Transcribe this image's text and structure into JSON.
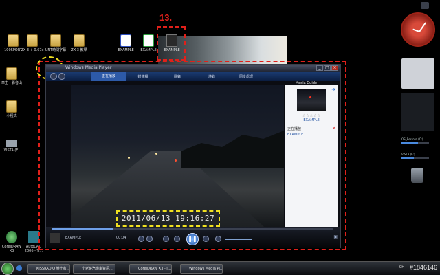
{
  "annotation": {
    "step_label": "13."
  },
  "desktop_icons": [
    {
      "label": "100SPORT"
    },
    {
      "label": "ZX-3 + 0.67x"
    },
    {
      "label": "UNT時間字幕"
    },
    {
      "label": "ZX-3 教學"
    },
    {
      "label": "EXAMPLE"
    },
    {
      "label": "EXAMPLE"
    },
    {
      "label": "EXAMPLE"
    },
    {
      "label": "車主 - 影音山"
    },
    {
      "label": "小程式"
    },
    {
      "label": "VISTA (E)"
    },
    {
      "label": "CorelDRAW X3"
    },
    {
      "label": "AutoCAD 2006 - Tr..."
    }
  ],
  "player": {
    "title": "Windows Media Player",
    "tabs": [
      "正在播放",
      "媒體櫃",
      "翻錄",
      "燒錄",
      "同步處理"
    ],
    "media_guide": "Media Guide",
    "window_controls": [
      "_",
      "□",
      "×"
    ],
    "timestamp": "2011/06/13  19:16:27",
    "side_panel": {
      "title": "EXAMPLE",
      "stars": "☆☆☆☆☆",
      "list_label": "正在播放",
      "list_item": "EXAMPLE",
      "remove_symbol": "×"
    },
    "controls": {
      "now_playing": "EXAMPLE",
      "elapsed": "00:04",
      "seek_percent": 22
    }
  },
  "gadgets": {
    "drives": [
      {
        "label": "OS_Restore (C:)",
        "fill_percent": 60
      },
      {
        "label": "VISTA (E:)",
        "fill_percent": 45
      }
    ]
  },
  "taskbar": {
    "buttons": [
      {
        "label": "KISSRADIO 樂士收..."
      },
      {
        "label": "小老婆汽機車資訊..."
      },
      {
        "label": "CorelDRAW X3 - [..."
      },
      {
        "label": "Windows Media Pl..."
      }
    ],
    "tray_text": "CH"
  },
  "watermark": "#1846146"
}
